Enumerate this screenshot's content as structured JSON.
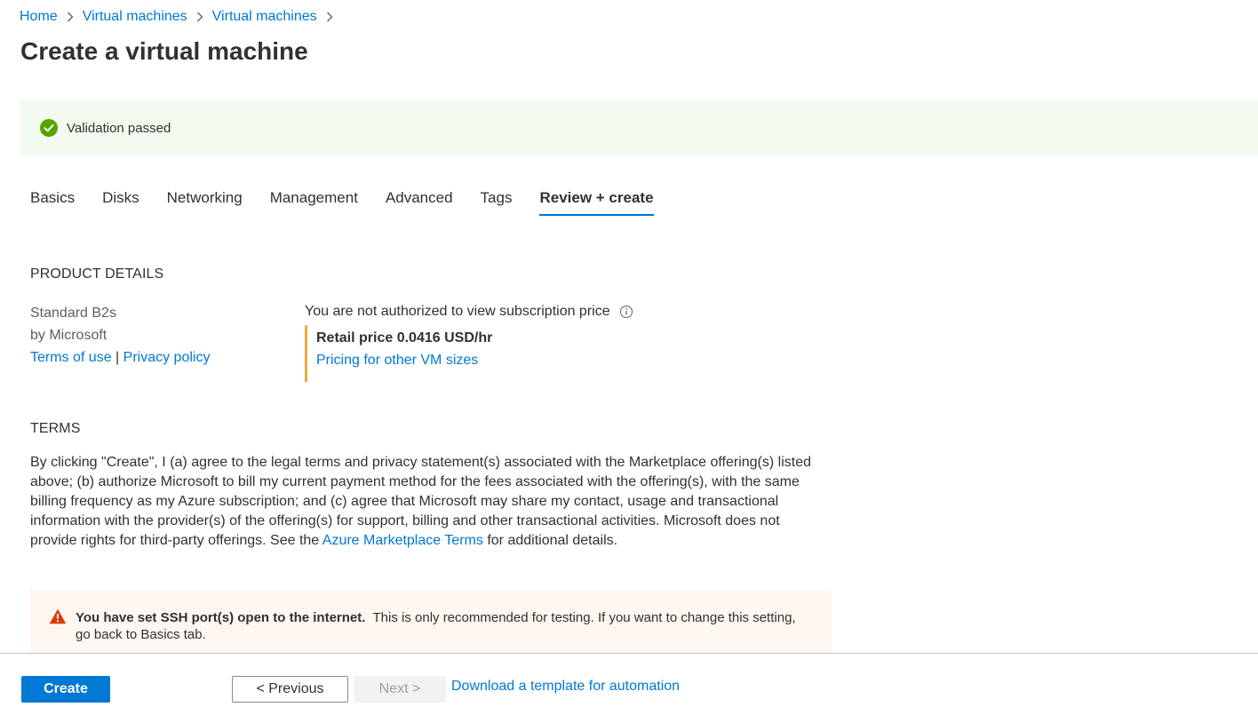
{
  "breadcrumb": {
    "items": [
      "Home",
      "Virtual machines",
      "Virtual machines"
    ]
  },
  "page": {
    "title": "Create a virtual machine"
  },
  "validation": {
    "text": "Validation passed",
    "color": "#57a300"
  },
  "tabs": [
    {
      "label": "Basics"
    },
    {
      "label": "Disks"
    },
    {
      "label": "Networking"
    },
    {
      "label": "Management"
    },
    {
      "label": "Advanced"
    },
    {
      "label": "Tags"
    },
    {
      "label": "Review + create",
      "active": true
    }
  ],
  "product_details": {
    "heading": "PRODUCT DETAILS",
    "name": "Standard B2s",
    "publisher": "by Microsoft",
    "terms_link": "Terms of use",
    "separator": "|",
    "privacy_link": "Privacy policy",
    "price_note": "You are not authorized to view subscription price",
    "retail_price": "Retail price 0.0416 USD/hr",
    "pricing_link": "Pricing for other VM sizes"
  },
  "terms": {
    "heading": "TERMS",
    "body_before_link": "By clicking \"Create\", I (a) agree to the legal terms and privacy statement(s) associated with the Marketplace offering(s) listed above; (b) authorize Microsoft to bill my current payment method for the fees associated with the offering(s), with the same billing frequency as my Azure subscription; and (c) agree that Microsoft may share my contact, usage and transactional information with the provider(s) of the offering(s) for support, billing and other transactional activities. Microsoft does not provide rights for third-party offerings. See the ",
    "link": "Azure Marketplace Terms",
    "body_after_link": " for additional details."
  },
  "warning": {
    "bold": "You have set SSH port(s) open to the internet.",
    "text": "This is only recommended for testing.  If you want to change this setting, go back to Basics tab.",
    "color": "#d83b01"
  },
  "footer": {
    "create": "Create",
    "previous": "< Previous",
    "next": "Next >",
    "download": "Download a template for automation"
  },
  "colors": {
    "accent": "#0078d4",
    "price_border": "#f2a93b"
  }
}
